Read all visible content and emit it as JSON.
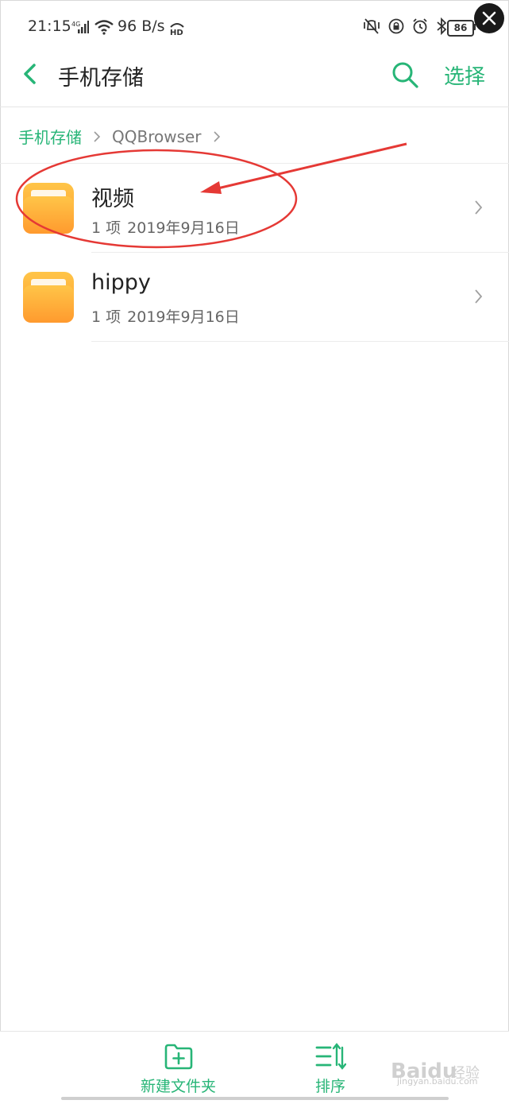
{
  "status_bar": {
    "time": "21:15",
    "net_label": "4G",
    "speed": "96 B/s",
    "hd_label": "HD",
    "battery": "86"
  },
  "header": {
    "title": "手机存储",
    "select_label": "选择"
  },
  "breadcrumb": {
    "home": "手机存储",
    "current": "QQBrowser"
  },
  "files": [
    {
      "name": "视频",
      "count": "1 项",
      "date": "2019年9月16日"
    },
    {
      "name": "hippy",
      "count": "1 项",
      "date": "2019年9月16日"
    }
  ],
  "bottom_bar": {
    "new_folder_label": "新建文件夹",
    "sort_label": "排序"
  },
  "watermark": {
    "brand": "Baidu",
    "brand_cn": "经验",
    "url": "jingyan.baidu.com"
  },
  "colors": {
    "accent": "#27b577",
    "folder_top": "#ffc548",
    "folder_bottom": "#ff9a2e",
    "annotation": "#e53935"
  },
  "icons": {
    "back": "chevron-left-icon",
    "search": "search-icon",
    "close": "close-icon",
    "folder": "folder-icon",
    "new_folder": "folder-plus-icon",
    "sort": "sort-icon"
  }
}
